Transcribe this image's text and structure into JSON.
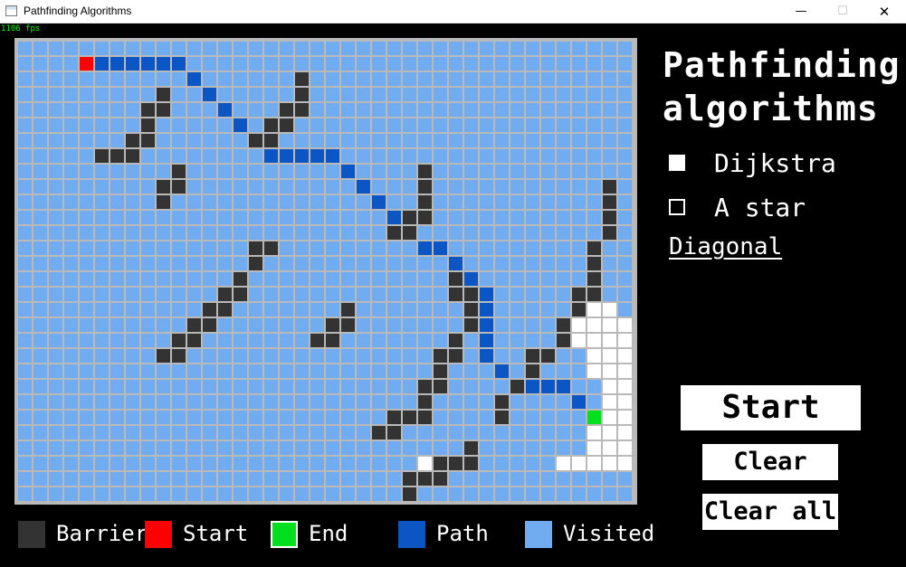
{
  "window": {
    "title": "Pathfinding Algorithms",
    "minimize_glyph": "—",
    "maximize_glyph": "☐",
    "close_glyph": "✕",
    "icon": "app-window-icon"
  },
  "fps_counter": "1106 fps",
  "heading": {
    "line1": "Pathfinding",
    "line2": "algorithms"
  },
  "algorithms": [
    {
      "label": "Dijkstra",
      "selected": true
    },
    {
      "label": "A star",
      "selected": false
    }
  ],
  "diagonal_label": "Diagonal",
  "buttons": {
    "start": "Start",
    "clear": "Clear",
    "clear_all": "Clear all"
  },
  "colors": {
    "visited": "#72acf0",
    "path": "#0c55c4",
    "barrier": "#333333",
    "start": "#ff0000",
    "end": "#00e020",
    "unvisited": "#ffffff",
    "gridline": "#b9b9b9"
  },
  "legend": [
    {
      "key": "barrier",
      "label": "Barrier",
      "color": "#333333"
    },
    {
      "key": "start",
      "label": "Start",
      "color": "#ff0000"
    },
    {
      "key": "end",
      "label": "End",
      "color": "#00e020"
    },
    {
      "key": "path",
      "label": "Path",
      "color": "#0c55c4"
    },
    {
      "key": "visited",
      "label": "Visited",
      "color": "#72acf0"
    }
  ],
  "grid": {
    "cols": 40,
    "rows": 30,
    "default_state": "visited",
    "start": [
      4,
      3
    ],
    "end": [
      37,
      26
    ],
    "path": [
      [
        5,
        3
      ],
      [
        6,
        3
      ],
      [
        7,
        3
      ],
      [
        8,
        3
      ],
      [
        9,
        3
      ],
      [
        10,
        3
      ],
      [
        11,
        4
      ],
      [
        12,
        5
      ],
      [
        13,
        6
      ],
      [
        14,
        7
      ],
      [
        15,
        8
      ],
      [
        16,
        9
      ],
      [
        17,
        9
      ],
      [
        18,
        9
      ],
      [
        19,
        9
      ],
      [
        20,
        9
      ],
      [
        21,
        10
      ],
      [
        22,
        11
      ],
      [
        23,
        12
      ],
      [
        24,
        13
      ],
      [
        25,
        14
      ],
      [
        26,
        15
      ],
      [
        27,
        15
      ],
      [
        28,
        16
      ],
      [
        29,
        17
      ],
      [
        30,
        18
      ],
      [
        30,
        19
      ],
      [
        30,
        20
      ],
      [
        30,
        21
      ],
      [
        30,
        22
      ],
      [
        31,
        23
      ],
      [
        32,
        24
      ],
      [
        33,
        24
      ],
      [
        34,
        24
      ],
      [
        35,
        24
      ],
      [
        36,
        25
      ]
    ],
    "barriers": [
      [
        18,
        4
      ],
      [
        9,
        5
      ],
      [
        18,
        5
      ],
      [
        8,
        6
      ],
      [
        9,
        6
      ],
      [
        17,
        6
      ],
      [
        18,
        6
      ],
      [
        8,
        7
      ],
      [
        16,
        7
      ],
      [
        17,
        7
      ],
      [
        7,
        8
      ],
      [
        8,
        8
      ],
      [
        15,
        8
      ],
      [
        16,
        8
      ],
      [
        5,
        9
      ],
      [
        6,
        9
      ],
      [
        7,
        9
      ],
      [
        10,
        10
      ],
      [
        26,
        10
      ],
      [
        9,
        11
      ],
      [
        10,
        11
      ],
      [
        26,
        11
      ],
      [
        38,
        11
      ],
      [
        9,
        12
      ],
      [
        26,
        12
      ],
      [
        38,
        12
      ],
      [
        25,
        13
      ],
      [
        26,
        13
      ],
      [
        38,
        13
      ],
      [
        24,
        14
      ],
      [
        25,
        14
      ],
      [
        38,
        14
      ],
      [
        15,
        15
      ],
      [
        16,
        15
      ],
      [
        37,
        15
      ],
      [
        15,
        16
      ],
      [
        37,
        16
      ],
      [
        14,
        17
      ],
      [
        28,
        17
      ],
      [
        37,
        17
      ],
      [
        13,
        18
      ],
      [
        14,
        18
      ],
      [
        28,
        18
      ],
      [
        29,
        18
      ],
      [
        36,
        18
      ],
      [
        37,
        18
      ],
      [
        12,
        19
      ],
      [
        13,
        19
      ],
      [
        21,
        19
      ],
      [
        29,
        19
      ],
      [
        36,
        19
      ],
      [
        11,
        20
      ],
      [
        12,
        20
      ],
      [
        20,
        20
      ],
      [
        21,
        20
      ],
      [
        29,
        20
      ],
      [
        35,
        20
      ],
      [
        10,
        21
      ],
      [
        11,
        21
      ],
      [
        19,
        21
      ],
      [
        20,
        21
      ],
      [
        28,
        21
      ],
      [
        35,
        21
      ],
      [
        9,
        22
      ],
      [
        10,
        22
      ],
      [
        27,
        22
      ],
      [
        28,
        22
      ],
      [
        33,
        22
      ],
      [
        34,
        22
      ],
      [
        27,
        23
      ],
      [
        33,
        23
      ],
      [
        26,
        24
      ],
      [
        27,
        24
      ],
      [
        32,
        24
      ],
      [
        26,
        25
      ],
      [
        31,
        25
      ],
      [
        24,
        26
      ],
      [
        25,
        26
      ],
      [
        26,
        26
      ],
      [
        31,
        26
      ],
      [
        23,
        27
      ],
      [
        24,
        27
      ],
      [
        29,
        28
      ],
      [
        27,
        29
      ],
      [
        28,
        29
      ],
      [
        29,
        29
      ],
      [
        25,
        30
      ],
      [
        26,
        30
      ],
      [
        27,
        30
      ],
      [
        25,
        31
      ]
    ],
    "unvisited": [
      [
        37,
        19
      ],
      [
        38,
        19
      ],
      [
        36,
        20
      ],
      [
        37,
        20
      ],
      [
        38,
        20
      ],
      [
        39,
        20
      ],
      [
        36,
        21
      ],
      [
        37,
        21
      ],
      [
        38,
        21
      ],
      [
        39,
        21
      ],
      [
        37,
        22
      ],
      [
        38,
        22
      ],
      [
        39,
        22
      ],
      [
        37,
        23
      ],
      [
        38,
        23
      ],
      [
        39,
        23
      ],
      [
        38,
        24
      ],
      [
        39,
        24
      ],
      [
        38,
        25
      ],
      [
        39,
        25
      ],
      [
        38,
        26
      ],
      [
        39,
        26
      ],
      [
        37,
        27
      ],
      [
        38,
        27
      ],
      [
        39,
        27
      ],
      [
        37,
        28
      ],
      [
        38,
        28
      ],
      [
        39,
        28
      ],
      [
        37,
        29
      ],
      [
        38,
        29
      ],
      [
        39,
        29
      ],
      [
        26,
        29
      ],
      [
        35,
        29
      ],
      [
        36,
        29
      ]
    ]
  }
}
